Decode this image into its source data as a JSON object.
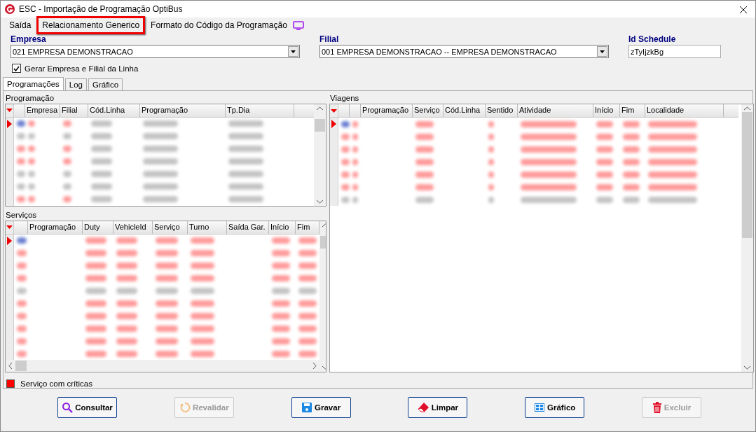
{
  "window": {
    "title": "ESC - Importação de Programação OptiBus"
  },
  "menu": [
    {
      "label": "Saída",
      "highlighted": false
    },
    {
      "label": "Relacionamento Generico",
      "highlighted": true
    },
    {
      "label": "Formato do Código da Programação",
      "highlighted": false
    }
  ],
  "fields": {
    "empresa": {
      "label": "Empresa",
      "value": "021 EMPRESA DEMONSTRACAO"
    },
    "filial": {
      "label": "Filial",
      "value": "001 EMPRESA DEMONSTRACAO -- EMPRESA DEMONSTRACAO"
    },
    "id_schedule": {
      "label": "Id Schedule",
      "value": "zTyIjzkBg"
    }
  },
  "gerar_checkbox": {
    "label": "Gerar Empresa e Filial da Linha",
    "checked": true
  },
  "tabs": [
    {
      "label": "Programações",
      "selected": true
    },
    {
      "label": "Log",
      "selected": false
    },
    {
      "label": "Gráfico",
      "selected": false
    }
  ],
  "grids": [
    {
      "title": "Programação",
      "columns": [
        "",
        "Empresa",
        "Filial",
        "Cód.Linha",
        "Programação",
        "Tp.Dia"
      ],
      "rows": [
        {
          "selected": true,
          "critical": true
        },
        {
          "selected": false,
          "critical": false
        },
        {
          "selected": false,
          "critical": true
        },
        {
          "selected": false,
          "critical": true
        },
        {
          "selected": false,
          "critical": false
        },
        {
          "selected": false,
          "critical": false
        },
        {
          "selected": false,
          "critical": true
        }
      ]
    },
    {
      "title": "Serviços",
      "columns": [
        "",
        "Programação",
        "Duty",
        "VehicleId",
        "Serviço",
        "Turno",
        "Saída Gar.",
        "Início",
        "Fim"
      ],
      "rows": [
        {
          "selected": true,
          "critical": true
        },
        {
          "selected": false,
          "critical": true
        },
        {
          "selected": false,
          "critical": true
        },
        {
          "selected": false,
          "critical": true
        },
        {
          "selected": false,
          "critical": false
        },
        {
          "selected": false,
          "critical": true
        },
        {
          "selected": false,
          "critical": true
        },
        {
          "selected": false,
          "critical": true
        },
        {
          "selected": false,
          "critical": true
        },
        {
          "selected": false,
          "critical": true
        }
      ]
    },
    {
      "title": "Viagens",
      "columns": [
        "",
        "",
        "Programação",
        "Serviço",
        "Cód.Linha",
        "Sentido",
        "Atividade",
        "Início",
        "Fim",
        "Localidade"
      ],
      "rows": [
        {
          "selected": true,
          "critical": true
        },
        {
          "selected": false,
          "critical": true
        },
        {
          "selected": false,
          "critical": true
        },
        {
          "selected": false,
          "critical": true
        },
        {
          "selected": false,
          "critical": true
        },
        {
          "selected": false,
          "critical": true
        },
        {
          "selected": false,
          "critical": false
        }
      ]
    }
  ],
  "legend": {
    "label": "Serviço com críticas",
    "color": "#ff0000"
  },
  "buttons": [
    {
      "label": "Consultar",
      "kind": "search",
      "disabled": false
    },
    {
      "label": "Revalidar",
      "kind": "refresh",
      "disabled": true
    },
    {
      "label": "Gravar",
      "kind": "save",
      "disabled": false
    },
    {
      "label": "Limpar",
      "kind": "eraser",
      "disabled": false
    },
    {
      "label": "Gráfico",
      "kind": "grid",
      "disabled": false
    },
    {
      "label": "Excluir",
      "kind": "trash",
      "disabled": true
    }
  ]
}
